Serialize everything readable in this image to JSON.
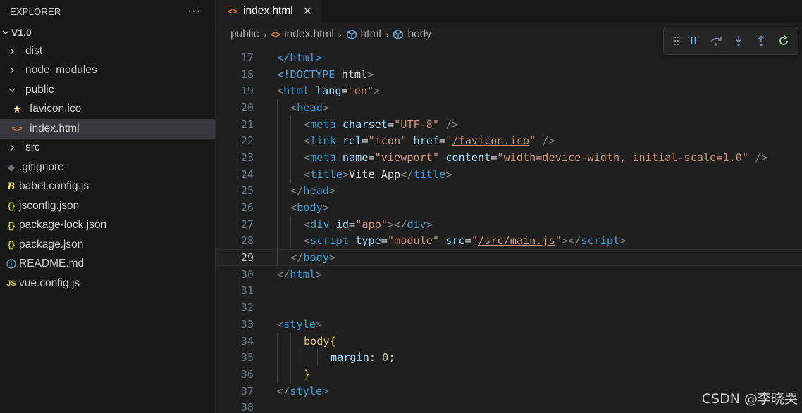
{
  "sidebar": {
    "title": "EXPLORER",
    "more": "···",
    "root": "V1.0",
    "items": [
      {
        "label": "dist",
        "type": "folder"
      },
      {
        "label": "node_modules",
        "type": "folder"
      },
      {
        "label": "public",
        "type": "folder-open"
      },
      {
        "label": "favicon.ico",
        "type": "file",
        "icon": "star-icon"
      },
      {
        "label": "index.html",
        "type": "file",
        "icon": "html-icon"
      },
      {
        "label": "src",
        "type": "folder"
      },
      {
        "label": ".gitignore",
        "type": "file",
        "icon": "git-icon"
      },
      {
        "label": "babel.config.js",
        "type": "file",
        "icon": "babel-icon"
      },
      {
        "label": "jsconfig.json",
        "type": "file",
        "icon": "json-icon"
      },
      {
        "label": "package-lock.json",
        "type": "file",
        "icon": "json-icon"
      },
      {
        "label": "package.json",
        "type": "file",
        "icon": "json-icon"
      },
      {
        "label": "README.md",
        "type": "file",
        "icon": "info-icon"
      },
      {
        "label": "vue.config.js",
        "type": "file",
        "icon": "js-icon"
      }
    ]
  },
  "tab": {
    "label": "index.html",
    "close": "✕"
  },
  "breadcrumb": {
    "parts": [
      "public",
      "index.html",
      "html",
      "body"
    ]
  },
  "code": {
    "current_line": 29,
    "lines": [
      "17",
      "18",
      "19",
      "20",
      "21",
      "22",
      "23",
      "24",
      "25",
      "26",
      "27",
      "28",
      "29",
      "30",
      "31",
      "32",
      "33",
      "34",
      "35",
      "36",
      "37",
      "38"
    ]
  },
  "strings": {
    "l17": "</html>",
    "l18_a": "<!DOCTYPE",
    "l18_b": " html",
    "lang": "lang",
    "en": "\"en\"",
    "charset": "charset",
    "utf8": "\"UTF-8\"",
    "rel": "rel",
    "icon": "\"icon\"",
    "href": "href",
    "favicon": "/favicon.ico",
    "name": "name",
    "viewport": "\"viewport\"",
    "content": "content",
    "content_val": "\"width=device-width, initial-scale=1.0\"",
    "title_text": "Vite App",
    "id": "id",
    "app": "\"app\"",
    "type": "type",
    "module": "\"module\"",
    "src": "src",
    "mainjs": "/src/main.js",
    "body_sel": "body",
    "margin": "margin",
    "zero": "0"
  },
  "watermark": "CSDN @李晓哭",
  "colors": {
    "accent": "#0078d4",
    "tag": "#3c9cd6",
    "attr": "#9cdcfe",
    "string": "#ce9178"
  }
}
